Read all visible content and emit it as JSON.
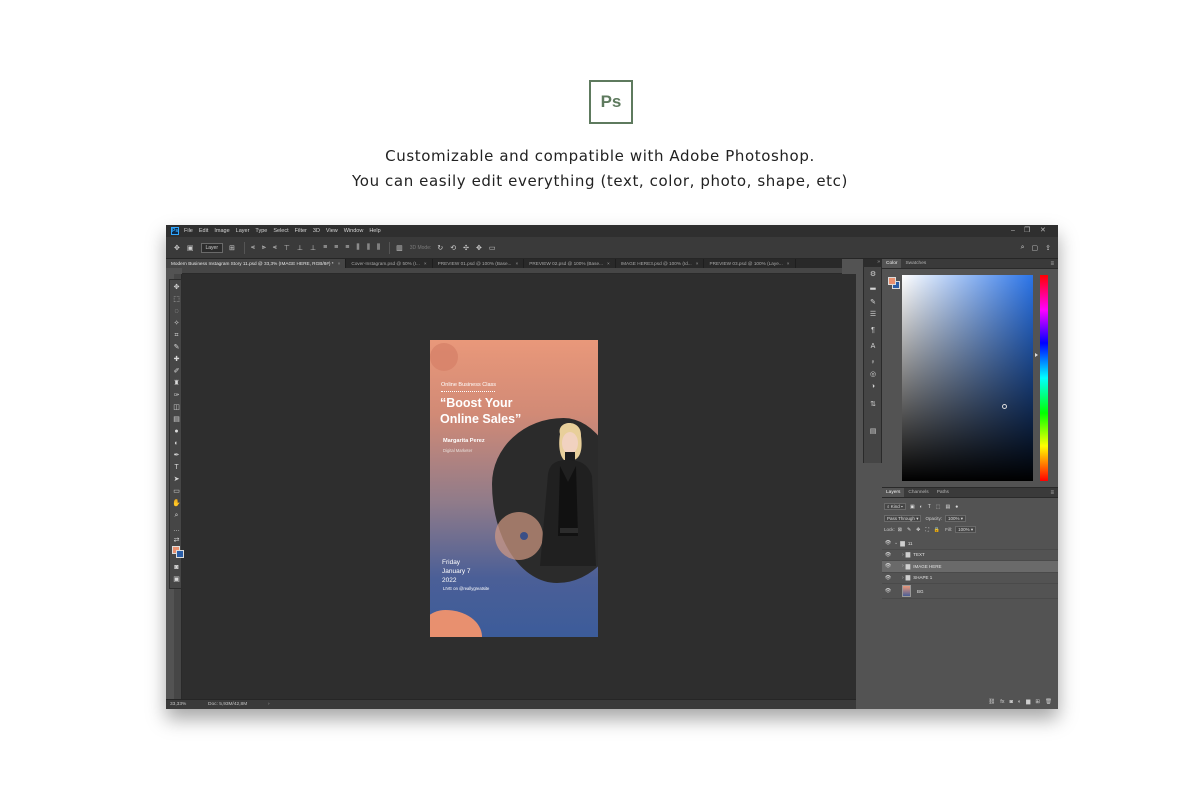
{
  "header": {
    "logo_text": "Ps",
    "line1": "Customizable and compatible with Adobe Photoshop.",
    "line2": "You can easily edit everything (text, color, photo, shape, etc)"
  },
  "app": {
    "menu": [
      "File",
      "Edit",
      "Image",
      "Layer",
      "Type",
      "Select",
      "Filter",
      "3D",
      "View",
      "Window",
      "Help"
    ],
    "window_controls": [
      "–",
      "❐",
      "✕"
    ],
    "options": {
      "layer_select": "Layer",
      "mode_3d": "3D Mode:"
    },
    "tabs": [
      {
        "label": "Modern Business Instagram Story 11.psd @ 33,3% (IMAGE HERE, RGB/8#) *",
        "active": true
      },
      {
        "label": "Cover-Instagram.psd @ 50% (I...",
        "active": false
      },
      {
        "label": "PREVIEW 01.psd @ 100% (Base...",
        "active": false
      },
      {
        "label": "PREVIEW 02.psd @ 100% (Base...",
        "active": false
      },
      {
        "label": "IMAGE HERE3.psd @ 100% (Id...",
        "active": false
      },
      {
        "label": "PREVIEW 03.psd @ 100% (Laye...",
        "active": false
      }
    ],
    "status": {
      "zoom": "33,33%",
      "doc": "Doc: 5,93M/42,8M"
    },
    "colors": {
      "foreground": "#e8906f",
      "background": "#2a5ea8"
    }
  },
  "document": {
    "label": "Online Business Class",
    "title_line1": "“Boost Your",
    "title_line2": "Online Sales”",
    "name": "Margarita Perez",
    "role": "Digital Marketer",
    "date_line1": "Friday",
    "date_line2": "January 7",
    "date_line3": "2022",
    "live": "LIVE on @reallygreatsite"
  },
  "panels": {
    "color_tabs": [
      "Color",
      "Swatches"
    ],
    "layers_tabs": [
      "Layers",
      "Channels",
      "Paths"
    ],
    "kind_filter": "Kind",
    "blend_mode": "Pass Through",
    "opacity_label": "Opacity:",
    "opacity_value": "100%",
    "lock_label": "Lock:",
    "fill_label": "Fill:",
    "fill_value": "100%",
    "layers": [
      {
        "name": "11",
        "type": "group",
        "indent": 0,
        "selected": false
      },
      {
        "name": "TEXT",
        "type": "group",
        "indent": 1,
        "selected": false
      },
      {
        "name": "IMAGE HERE",
        "type": "group",
        "indent": 1,
        "selected": true
      },
      {
        "name": "SHAPE 1",
        "type": "group",
        "indent": 1,
        "selected": false
      },
      {
        "name": "BG",
        "type": "layer",
        "indent": 1,
        "selected": false
      }
    ]
  }
}
